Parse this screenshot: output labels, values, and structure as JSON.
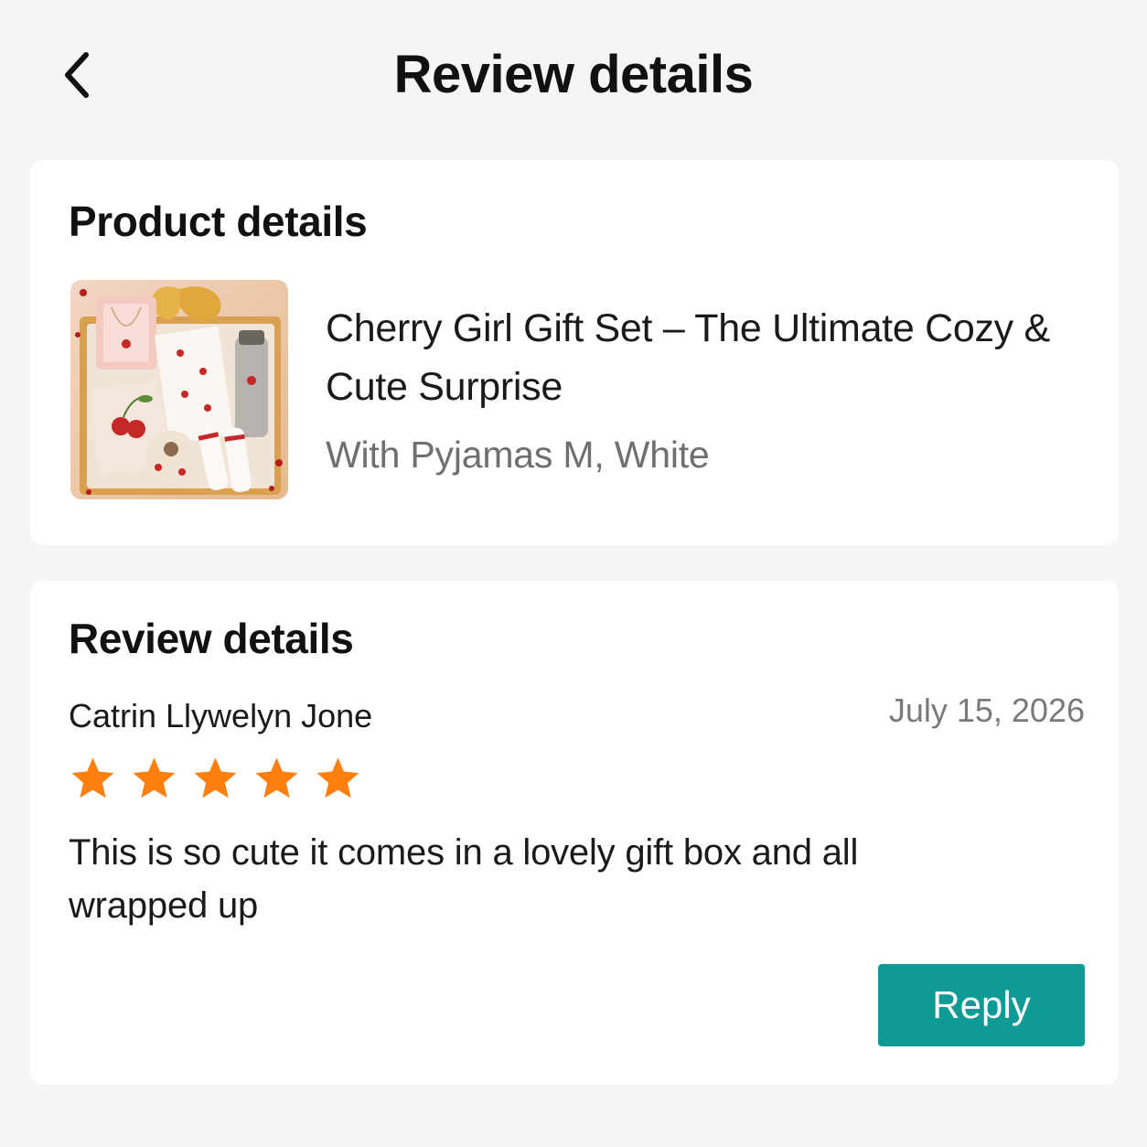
{
  "header": {
    "title": "Review details",
    "back_icon": "chevron-left-icon"
  },
  "product": {
    "section_title": "Product details",
    "name": "Cherry Girl Gift Set – The Ultimate Cozy & Cute Surprise",
    "variant": "With Pyjamas M, White"
  },
  "review": {
    "section_title": "Review details",
    "reviewer_name": "Catrin Llywelyn Jone",
    "date": "July 15, 2026",
    "rating": 5,
    "rating_max": 5,
    "text": "This is so cute it comes in a lovely gift box and all wrapped up",
    "reply_label": "Reply"
  },
  "colors": {
    "background": "#f4f5f6",
    "card": "#ffffff",
    "star": "#ff7f0e",
    "accent": "#0f9a95",
    "muted_text": "#6f6f6f"
  }
}
